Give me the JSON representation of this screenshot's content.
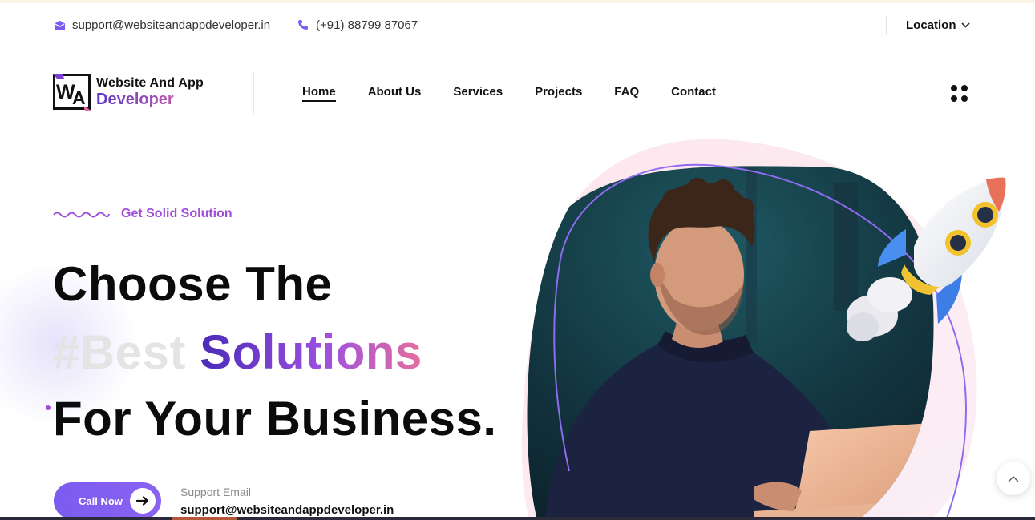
{
  "topbar": {
    "email_icon": "envelope-icon",
    "email": "support@websiteandappdeveloper.in",
    "phone_icon": "phone-icon",
    "phone": "(+91) 88799 87067",
    "location_label": "Location",
    "location_icon": "chevron-down-icon"
  },
  "header": {
    "logo_mark": "WA",
    "logo_line1": "Website And App",
    "logo_line2": "Developer",
    "nav": [
      {
        "label": "Home",
        "active": true
      },
      {
        "label": "About Us"
      },
      {
        "label": "Services"
      },
      {
        "label": "Projects"
      },
      {
        "label": "FAQ"
      },
      {
        "label": "Contact"
      }
    ],
    "menu_icon": "grid-dots-icon"
  },
  "hero": {
    "eyebrow": "Get Solid Solution",
    "eyebrow_icon": "wave-line-icon",
    "line1": "Choose The",
    "line2_muted": "#Best",
    "line2_gradient": "Solutions",
    "line3": "For Your Business.",
    "cta_label": "Call Now",
    "cta_icon": "arrow-right-icon",
    "support_label": "Support Email",
    "support_email": "support@websiteandappdeveloper.in",
    "image_icon": "man-with-laptop-photo",
    "rocket_icon": "rocket-icon"
  },
  "scroll_top_icon": "chevron-up-icon",
  "colors": {
    "accent": "#7b5cf0",
    "gradient_start": "#4a2bb8",
    "gradient_end": "#e56f9e",
    "eyebrow": "#a04fd9"
  }
}
